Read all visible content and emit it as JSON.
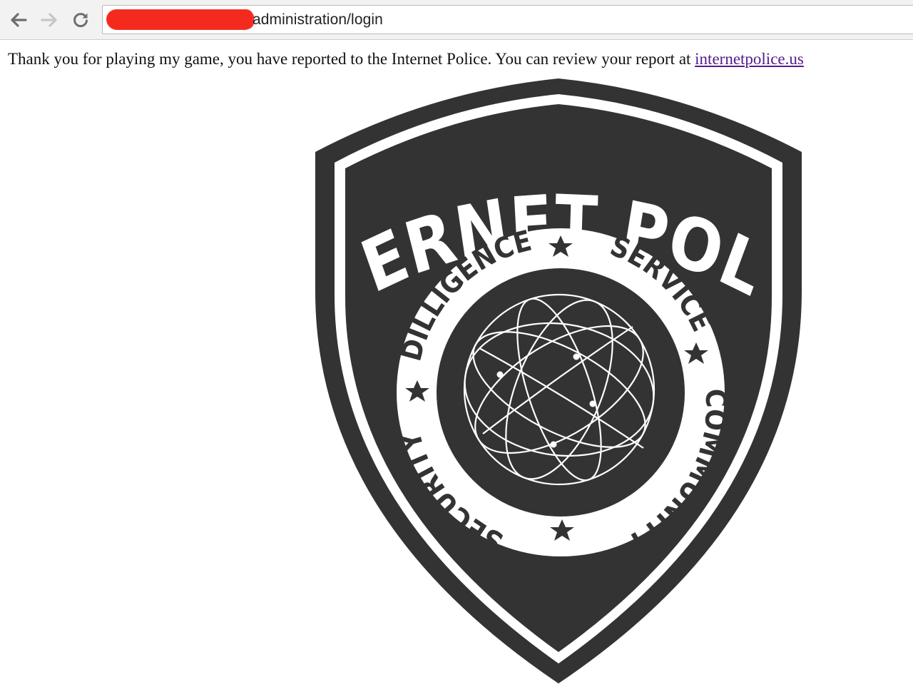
{
  "browser": {
    "url_visible": "administration/login",
    "icons": {
      "back": "arrow-left-icon",
      "forward": "arrow-right-icon",
      "reload": "reload-icon"
    }
  },
  "page": {
    "message": "Thank you for playing my game, you have reported to the Internet Police. You can review your report at ",
    "link_text": "internetpolice.us",
    "link_color": "#551a8b"
  },
  "badge": {
    "title": "INTERNET POLICE",
    "ring_words": [
      "DILLIGENCE",
      "SERVICE",
      "COMMUNITY",
      "SECURITY"
    ],
    "color_dark": "#333333",
    "color_light": "#ffffff"
  }
}
